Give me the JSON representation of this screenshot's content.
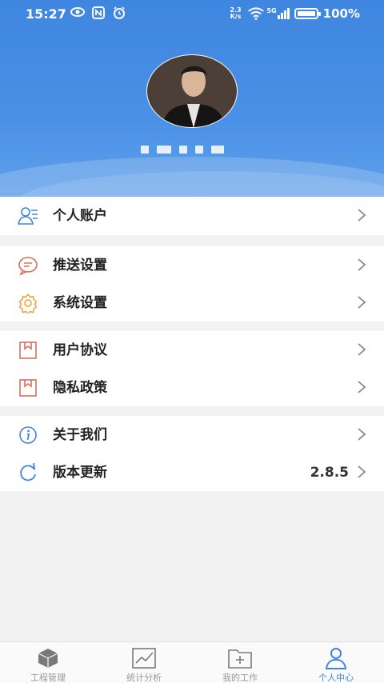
{
  "status_bar": {
    "time": "15:27",
    "net_speed_top": "2.3",
    "net_speed_bottom": "K/s",
    "signal_type": "5G",
    "battery": "100%"
  },
  "header": {
    "background_color": "#4a90e6"
  },
  "menu": {
    "section1": [
      {
        "label": "个人账户",
        "icon": "person-list-icon"
      }
    ],
    "section2": [
      {
        "label": "推送设置",
        "icon": "chat-bubble-icon"
      },
      {
        "label": "系统设置",
        "icon": "gear-icon"
      }
    ],
    "section3": [
      {
        "label": "用户协议",
        "icon": "document-icon"
      },
      {
        "label": "隐私政策",
        "icon": "document-icon"
      }
    ],
    "section4": [
      {
        "label": "关于我们",
        "icon": "info-icon"
      },
      {
        "label": "版本更新",
        "icon": "refresh-icon",
        "value": "2.8.5"
      }
    ]
  },
  "tabbar": {
    "tabs": [
      {
        "label": "工程管理",
        "icon": "cube-icon"
      },
      {
        "label": "统计分析",
        "icon": "chart-icon"
      },
      {
        "label": "我的工作",
        "icon": "folder-add-icon"
      },
      {
        "label": "个人中心",
        "icon": "person-icon",
        "active": true
      }
    ],
    "active_color": "#3f86e0"
  }
}
